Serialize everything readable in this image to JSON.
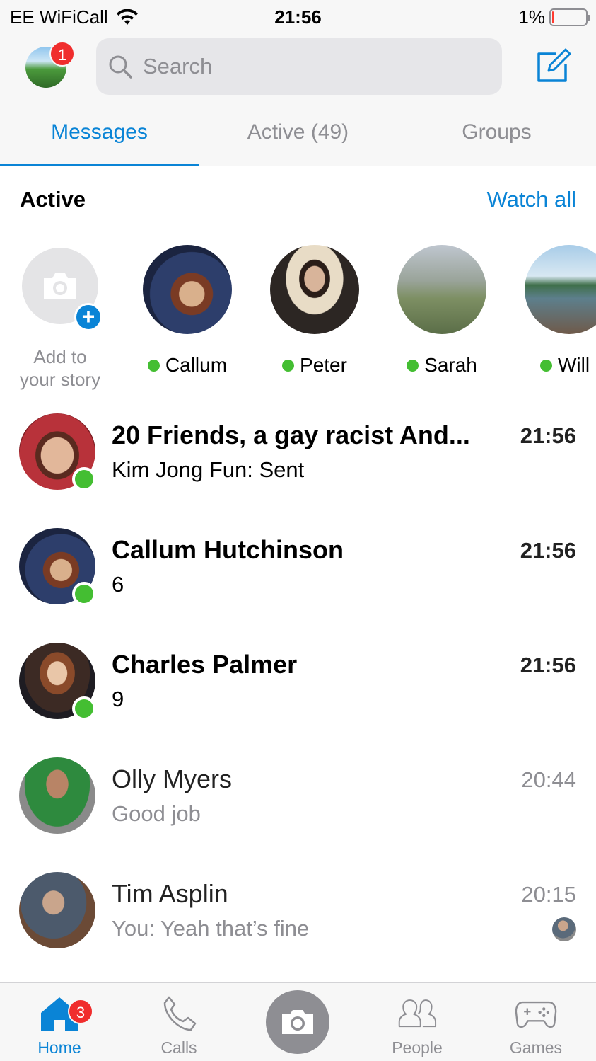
{
  "status_bar": {
    "carrier": "EE WiFiCall",
    "time": "21:56",
    "battery": "1%",
    "battery_level": 0.03
  },
  "header": {
    "profile_badge": "1",
    "search_placeholder": "Search",
    "icons": {
      "search": "search-icon",
      "compose": "compose-icon"
    }
  },
  "tabs": [
    {
      "label": "Messages",
      "active": true
    },
    {
      "label": "Active (49)",
      "active": false
    },
    {
      "label": "Groups",
      "active": false
    }
  ],
  "active_section": {
    "heading": "Active",
    "watch_all": "Watch all",
    "add_story_line1": "Add to",
    "add_story_line2": "your story",
    "stories": [
      {
        "name": "Callum",
        "online": true
      },
      {
        "name": "Peter",
        "online": true
      },
      {
        "name": "Sarah",
        "online": true
      },
      {
        "name": "Will",
        "online": true
      }
    ]
  },
  "conversations": [
    {
      "name": "20 Friends, a gay racist And...",
      "preview": "Kim Jong Fun: Sent",
      "time": "21:56",
      "unread": true,
      "online": true
    },
    {
      "name": "Callum Hutchinson",
      "preview": "6",
      "time": "21:56",
      "unread": true,
      "online": true
    },
    {
      "name": "Charles Palmer",
      "preview": "9",
      "time": "21:56",
      "unread": true,
      "online": true
    },
    {
      "name": "Olly Myers",
      "preview": "Good job",
      "time": "20:44",
      "unread": false,
      "online": false
    },
    {
      "name": "Tim Asplin",
      "preview": "You: Yeah that’s fine",
      "time": "20:15",
      "unread": false,
      "online": false
    }
  ],
  "bottom_nav": {
    "home": "Home",
    "home_badge": "3",
    "calls": "Calls",
    "people": "People",
    "games": "Games"
  },
  "colors": {
    "accent": "#0a84d6",
    "online": "#44be32",
    "badge": "#f02d2d",
    "muted": "#8e8e93"
  }
}
